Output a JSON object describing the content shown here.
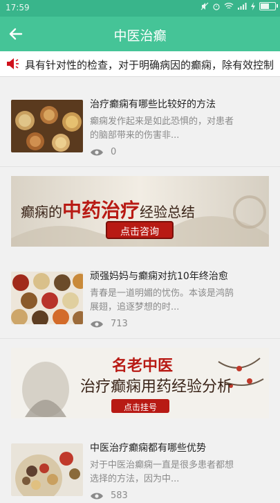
{
  "status_bar": {
    "time": "17:59",
    "icons": [
      "mute-icon",
      "alarm-icon",
      "wifi-icon",
      "signal-icon",
      "charging-icon",
      "battery-icon"
    ]
  },
  "app_bar": {
    "title": "中医治癫",
    "back_icon": "arrow-left-icon"
  },
  "marquee": {
    "icon": "speaker-icon",
    "text": "具有针对性的检查，对于明确病因的癫痫，除有效控制"
  },
  "articles": [
    {
      "title": "治疗癫痫有哪些比较好的方法",
      "summary_line1": "癫痫发作起来是如此恐惧的，对患者",
      "summary_line2": "的脑部带来的伤害非...",
      "views": "0"
    },
    {
      "title": "顽强妈妈与癫痫对抗10年终治愈",
      "summary_line1": "青春是一道明媚的忧伤。本该是鸿鹄",
      "summary_line2": "展翅，追逐梦想的时...",
      "views": "713"
    },
    {
      "title": "中医治疗癫痫都有哪些优势",
      "summary_line1": "对于中医治癫痫一直是很多患者都想",
      "summary_line2": "选择的方法，因为中...",
      "views": "583"
    }
  ],
  "banners": [
    {
      "title_part1": "癫痫的",
      "title_part2": "中药治疗",
      "title_part3": "经验总结",
      "button": "点击咨询"
    },
    {
      "line1": "名老中医",
      "line2": "治疗癫痫用药经验分析",
      "button": "点击挂号"
    }
  ],
  "colors": {
    "status_bar": "#39b58b",
    "app_bar": "#45c497",
    "accent_red": "#d0101c",
    "background": "#f1f1f1"
  }
}
